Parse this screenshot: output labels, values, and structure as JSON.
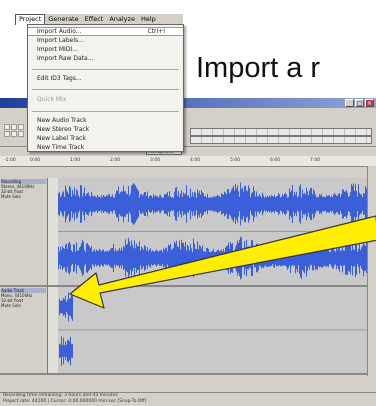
{
  "caption": "Import a r",
  "menubar": {
    "items": [
      "Project",
      "Generate",
      "Effect",
      "Analyze",
      "Help"
    ],
    "active": "Project"
  },
  "project_menu": {
    "import_audio": "Import Audio...",
    "import_audio_shortcut": "Ctrl+I",
    "import_labels": "Import Labels...",
    "import_midi": "Import MIDI...",
    "import_raw": "Import Raw Data...",
    "edit_id3": "Edit ID3 Tags...",
    "quick_mix": "Quick Mix",
    "new_audio_track": "New Audio Track",
    "new_stereo_track": "New Stereo Track",
    "new_label_track": "New Label Track",
    "new_time_track": "New Time Track"
  },
  "toolbar": {
    "device": "Microphone"
  },
  "tracks": [
    {
      "name": "Recording",
      "info": [
        "Stereo, 44100Hz",
        "32-bit float",
        "Mute  Solo"
      ]
    },
    {
      "name": "Audio Track",
      "info": [
        "Mono, 44100Hz",
        "32-bit float",
        "Mute  Solo"
      ]
    }
  ],
  "status": {
    "line1": "Recording time remaining: 3 hours and 43 minutes",
    "line2": "Project rate: 44100  |  Cursor: 0:00.000000 min:sec  [Snap-To Off]"
  },
  "colors": {
    "waveform": "#3a5fd8",
    "arrow": "#ffee00",
    "title_bar": "#1f3f9b"
  }
}
